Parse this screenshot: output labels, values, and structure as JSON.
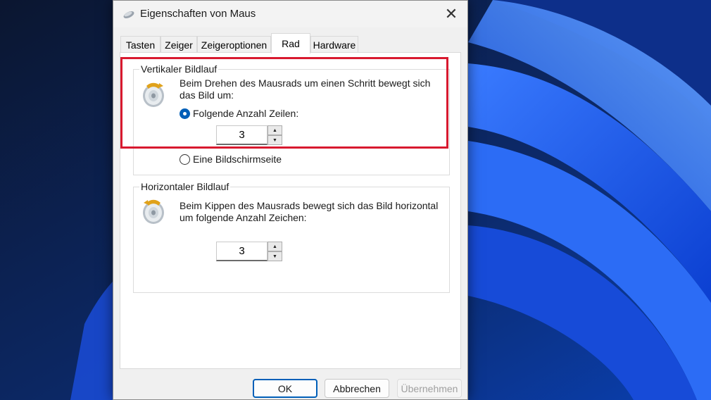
{
  "window": {
    "title": "Eigenschaften von Maus",
    "close_glyph": "✕"
  },
  "tabs": [
    {
      "label": "Tasten",
      "active": false
    },
    {
      "label": "Zeiger",
      "active": false
    },
    {
      "label": "Zeigeroptionen",
      "active": false
    },
    {
      "label": "Rad",
      "active": true
    },
    {
      "label": "Hardware",
      "active": false
    }
  ],
  "vertical": {
    "legend": "Vertikaler Bildlauf",
    "description_line1": "Beim Drehen des Mausrads um einen Schritt bewegt sich",
    "description_line2": "das Bild um:",
    "option_lines_label": "Folgende Anzahl Zeilen:",
    "option_lines_checked": true,
    "lines_value": "3",
    "option_page_label": "Eine Bildschirmseite",
    "option_page_checked": false
  },
  "horizontal": {
    "legend": "Horizontaler Bildlauf",
    "description_line1": "Beim Kippen des Mausrads bewegt sich das Bild horizontal",
    "description_line2": "um folgende Anzahl Zeichen:",
    "chars_value": "3"
  },
  "buttons": {
    "ok": "OK",
    "cancel": "Abbrechen",
    "apply": "Übernehmen",
    "apply_enabled": false
  },
  "spin": {
    "up": "▲",
    "down": "▼"
  },
  "colors": {
    "accent": "#005fb8",
    "highlight_box": "#d8192f"
  },
  "icons": {
    "window": "mouse-icon",
    "wheel": "mouse-wheel-icon"
  }
}
